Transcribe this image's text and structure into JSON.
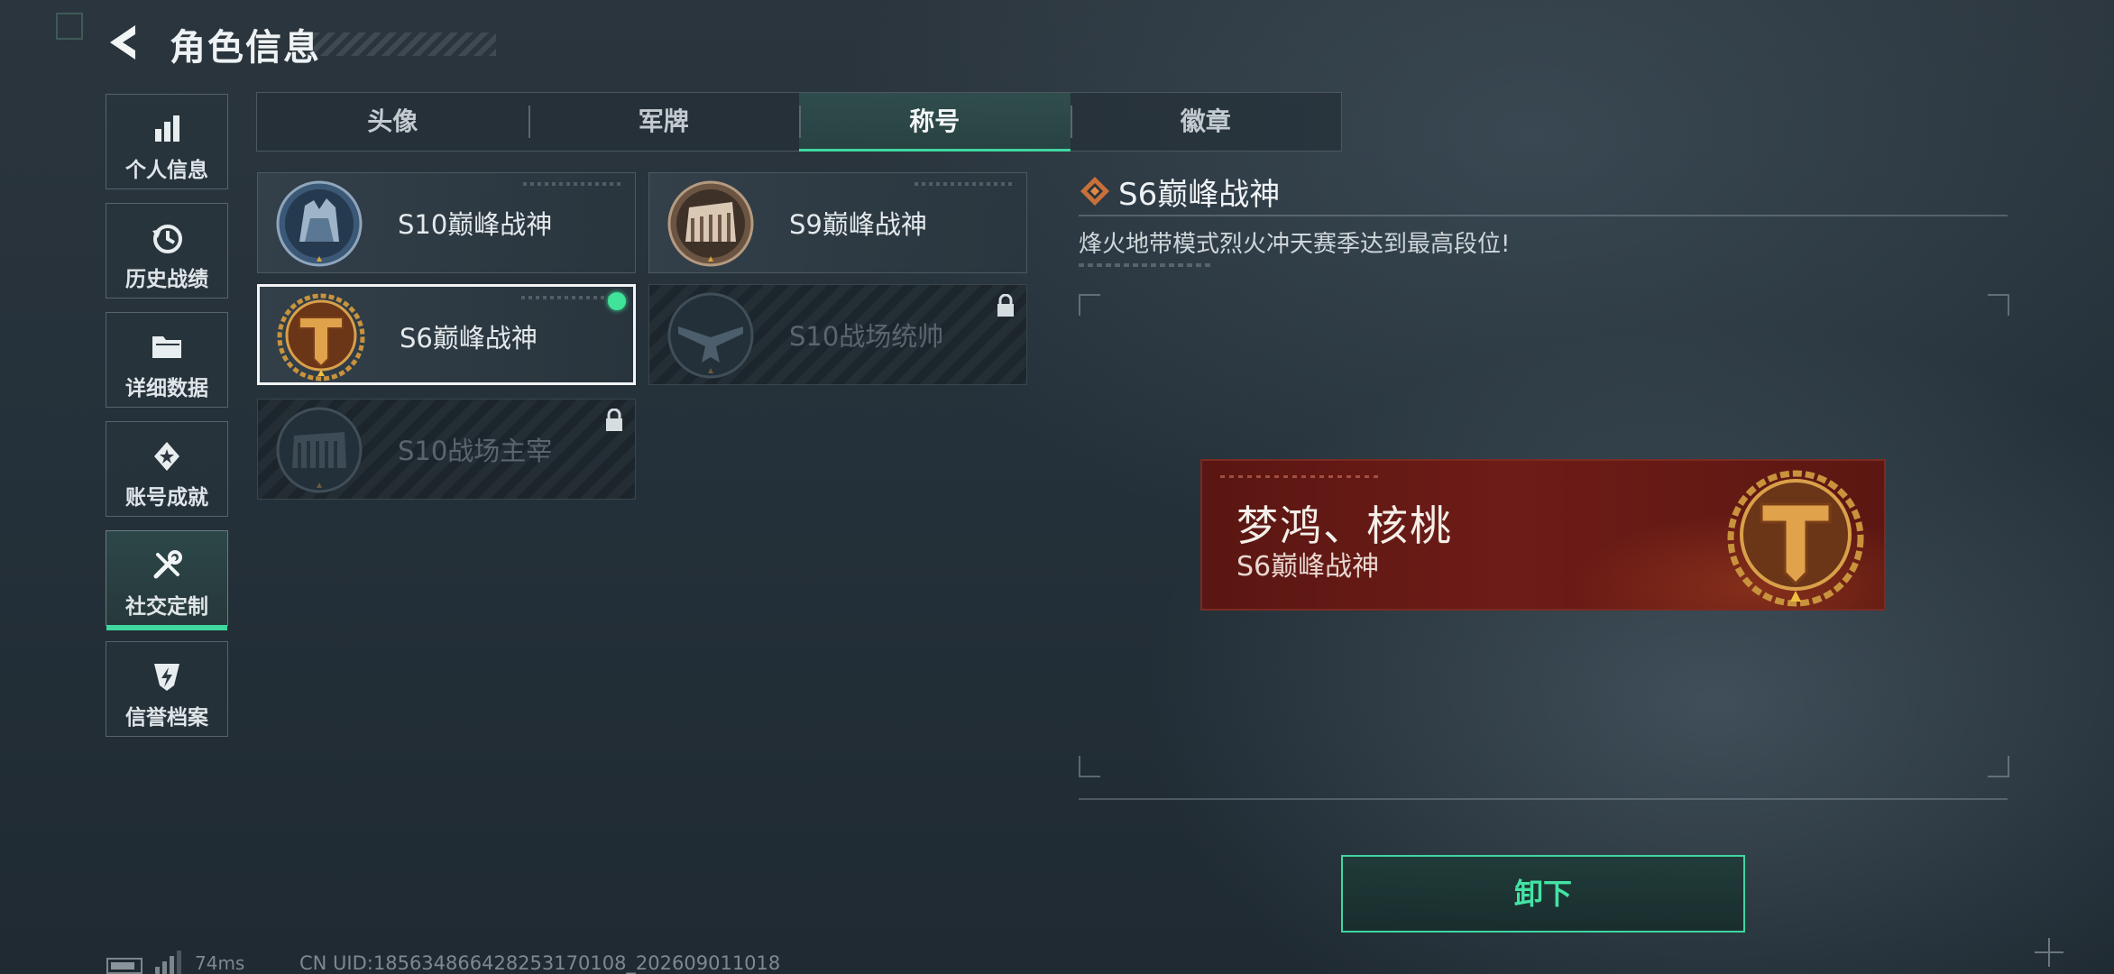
{
  "header": {
    "title": "角色信息"
  },
  "sidebar": {
    "items": [
      {
        "label": "个人信息",
        "icon": "bar-chart-icon"
      },
      {
        "label": "历史战绩",
        "icon": "clock-history-icon"
      },
      {
        "label": "详细数据",
        "icon": "folder-icon"
      },
      {
        "label": "账号成就",
        "icon": "achievement-badge-icon"
      },
      {
        "label": "社交定制",
        "icon": "tools-icon",
        "active": true
      },
      {
        "label": "信誉档案",
        "icon": "credit-shield-icon"
      }
    ]
  },
  "tabs": [
    {
      "label": "头像"
    },
    {
      "label": "军牌"
    },
    {
      "label": "称号",
      "active": true
    },
    {
      "label": "徽章"
    }
  ],
  "titles": [
    {
      "name": "S10巅峰战神",
      "emblem": "blue-fortress-emblem",
      "state": "unlocked"
    },
    {
      "name": "S9巅峰战神",
      "emblem": "bronze-fortress-emblem",
      "state": "unlocked"
    },
    {
      "name": "S6巅峰战神",
      "emblem": "gold-t-emblem",
      "state": "equipped"
    },
    {
      "name": "S10战场统帅",
      "emblem": "aircraft-emblem",
      "state": "locked"
    },
    {
      "name": "S10战场主宰",
      "emblem": "colosseum-emblem",
      "state": "locked"
    }
  ],
  "detail": {
    "title": "S6巅峰战神",
    "description": "烽火地带模式烈火冲天赛季达到最高段位!"
  },
  "nameplate": {
    "player_name": "梦鸿、核桃",
    "title": "S6巅峰战神"
  },
  "action": {
    "label": "卸下"
  },
  "footer": {
    "ping": "74ms",
    "uid": "CN UID:185634866428253170108_202609011018"
  },
  "colors": {
    "accent": "#3fd6a0",
    "plate_red": "#6e1c17",
    "gold": "#c8893a"
  }
}
